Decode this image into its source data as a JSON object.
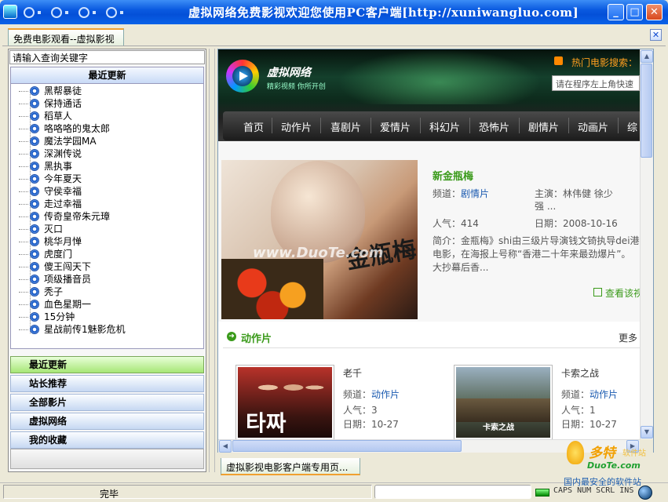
{
  "window": {
    "title": "虚拟网络免费影视欢迎您使用PC客户端[http://xuniwangluo.com]",
    "minimize_icon": "minimize-icon",
    "maximize_icon": "maximize-icon",
    "close_icon": "close-icon"
  },
  "tabs": {
    "main": "免费电影观看--虚拟影视",
    "bottom": "虚拟影视电影客户端专用页..."
  },
  "sidebar": {
    "search_placeholder": "请输入查询关键字",
    "recent_header": "最近更新",
    "items": [
      "黑帮暴徒",
      "保持通话",
      "稻草人",
      "咯咯咯的鬼太郎",
      "魔法学园MA",
      "深渊传说",
      "黑执事",
      "今年夏天",
      "守侯幸福",
      "走过幸福",
      "传奇皇帝朱元璋",
      "灭口",
      "桃华月惮",
      "虎度门",
      "傻王闯天下",
      "项级播音员",
      "秃子",
      "血色星期一",
      "15分钟",
      "星战前传1魅影危机"
    ],
    "nav": [
      "最近更新",
      "站长推荐",
      "全部影片",
      "虚拟网络",
      "我的收藏"
    ]
  },
  "site": {
    "logo_name": "虚拟网络",
    "logo_tagline": "精彩视频 你所开创",
    "hot_search_label": "热门电影搜索：",
    "search_placeholder": "请在程序左上角快速",
    "nav": [
      "首页",
      "动作片",
      "喜剧片",
      "爱情片",
      "科幻片",
      "恐怖片",
      "剧情片",
      "动画片",
      "综"
    ]
  },
  "feature": {
    "title": "新金瓶梅",
    "channel_label": "频道：",
    "channel": "剧情片",
    "cast_label": "主演：",
    "cast": "林伟健 徐少",
    "cast2": "强 ...",
    "popularity_label": "人气：",
    "popularity": "414",
    "date_label": "日期：",
    "date": "2008-10-16",
    "intro": "简介：金瓶梅》shi由三级片导演钱文锜执导dei港电影，在海报上号称“香港二十年来最劲爆片”。大抄幕后香...",
    "watch": "查看该视",
    "image_text": "金瓶梅",
    "watermark_overlay": "www.DuoTe.com"
  },
  "section": {
    "title": "动作片",
    "more": "更多",
    "movies": [
      {
        "title": "老千",
        "channel_label": "频道：",
        "channel": "动作片",
        "popularity_label": "人气：",
        "popularity": "3",
        "date_label": "日期：",
        "date": "10-27",
        "poster_text": "타짜"
      },
      {
        "title": "卡索之战",
        "channel_label": "频道：",
        "channel": "动作片",
        "popularity_label": "人气：",
        "popularity": "1",
        "date_label": "日期：",
        "date": "10-27",
        "poster_text": "卡索之战"
      }
    ]
  },
  "status": {
    "text": "完毕",
    "keys": "CAPS NUM SCRL INS"
  },
  "watermark": {
    "brand": "多特",
    "brand2": "软件站",
    "url": "DuoTe.com",
    "sub": "国内最安全的软件站"
  }
}
